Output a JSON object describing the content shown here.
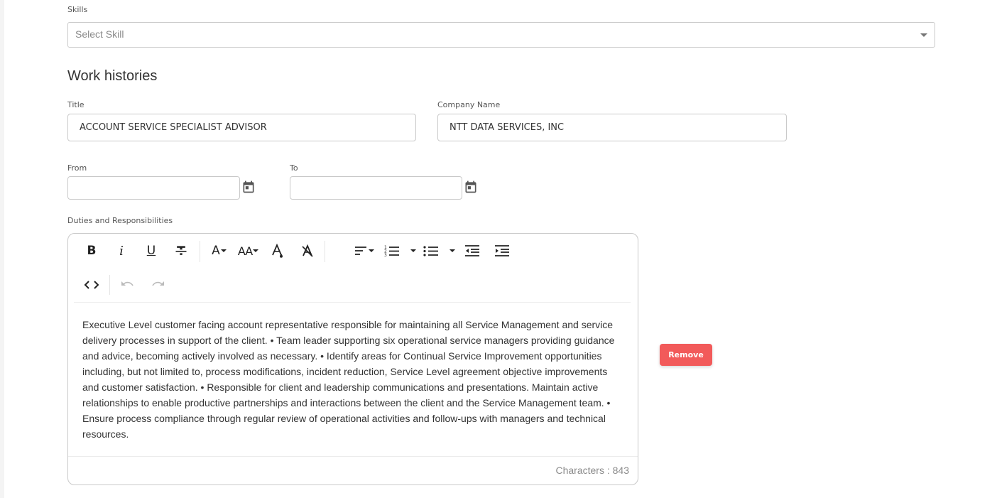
{
  "skills": {
    "label": "Skills",
    "placeholder": "Select Skill"
  },
  "work_histories": {
    "heading": "Work histories",
    "title_label": "Title",
    "title_value": "ACCOUNT SERVICE SPECIALIST ADVISOR",
    "company_label": "Company Name",
    "company_value": "NTT DATA SERVICES, INC",
    "from_label": "From",
    "from_value": "",
    "to_label": "To",
    "to_value": "",
    "duties_label": "Duties and Responsibilities",
    "duties_text": "Executive Level customer facing account representative responsible for maintaining all Service Management and service delivery processes in support of the client. • Team leader supporting six operational service managers providing guidance and advice, becoming actively involved as necessary. • Identify areas for Continual Service Improvement opportunities including, but not limited to, process modifications, incident reduction, Service Level agreement objective improvements and customer satisfaction. • Responsible for client and leadership communications and presentations. Maintain active relationships to enable productive partnerships and interactions between the client and the Service Management team. • Ensure process compliance through regular review of operational activities and follow-ups with managers and technical resources.",
    "char_count": "Characters : 843",
    "remove_label": "Remove"
  },
  "toolbar": {
    "bold": "B",
    "italic": "i",
    "underline": "U",
    "font_size_glyph": "A",
    "font_size_small": "A",
    "font_family_glyph": "AA"
  },
  "icons": [
    "bold-icon",
    "italic-icon",
    "underline-icon",
    "strikethrough-icon",
    "font-family-icon",
    "font-size-icon",
    "text-color-icon",
    "clear-format-icon",
    "align-icon",
    "ordered-list-icon",
    "unordered-list-icon",
    "outdent-icon",
    "indent-icon",
    "code-view-icon",
    "undo-icon",
    "redo-icon",
    "calendar-icon",
    "chevron-down-icon"
  ],
  "colors": {
    "remove_button": "#f25a5a",
    "border": "#c9c9c9"
  }
}
